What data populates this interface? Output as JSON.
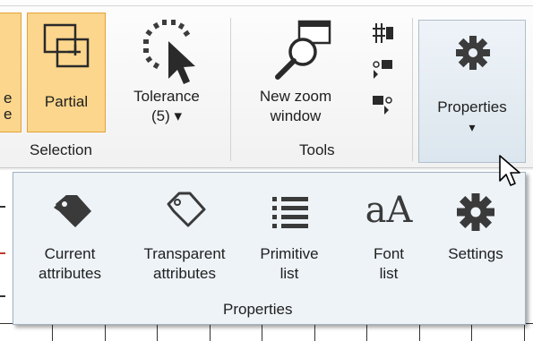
{
  "ribbon": {
    "partial_edge_label_1": "e",
    "partial_edge_label_2": "e",
    "partial_label": "Partial",
    "tolerance_label_1": "Tolerance",
    "tolerance_label_2": "(5) ▾",
    "selection_group_label": "Selection",
    "new_zoom_label_1": "New zoom",
    "new_zoom_label_2": "window",
    "tools_group_label": "Tools",
    "properties_label": "Properties",
    "properties_arrow": "▾"
  },
  "dropdown": {
    "items": [
      {
        "line1": "Current",
        "line2": "attributes",
        "icon": "tag-filled-icon"
      },
      {
        "line1": "Transparent",
        "line2": "attributes",
        "icon": "tag-outline-icon"
      },
      {
        "line1": "Primitive",
        "line2": "list",
        "icon": "list-icon"
      },
      {
        "line1": "Font",
        "line2": "list",
        "icon": "font-aa-icon"
      },
      {
        "line1": "Settings",
        "line2": "",
        "icon": "gear-icon"
      }
    ],
    "font_icon_text": "aA",
    "group_label": "Properties"
  },
  "colors": {
    "partial_highlight": "#fbd68c",
    "partial_border": "#e5a23a",
    "dropdown_bg": "#eef3f8",
    "icon_dark": "#3c3c3c"
  }
}
